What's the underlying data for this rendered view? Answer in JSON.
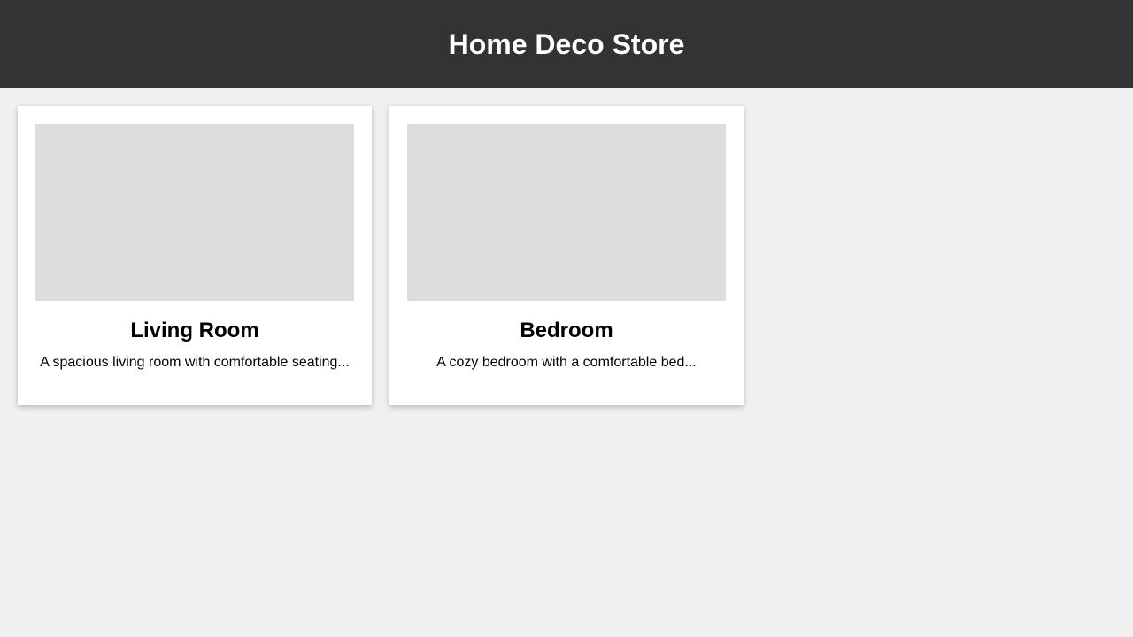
{
  "header": {
    "title": "Home Deco Store",
    "background_color": "#333333",
    "text_color": "#ffffff"
  },
  "page": {
    "background_color": "#f0f0f0"
  },
  "rooms": [
    {
      "title": "Living Room",
      "description": "A spacious living room with comfortable seating...",
      "image_placeholder_color": "#dddddd"
    },
    {
      "title": "Bedroom",
      "description": "A cozy bedroom with a comfortable bed...",
      "image_placeholder_color": "#dddddd"
    }
  ]
}
